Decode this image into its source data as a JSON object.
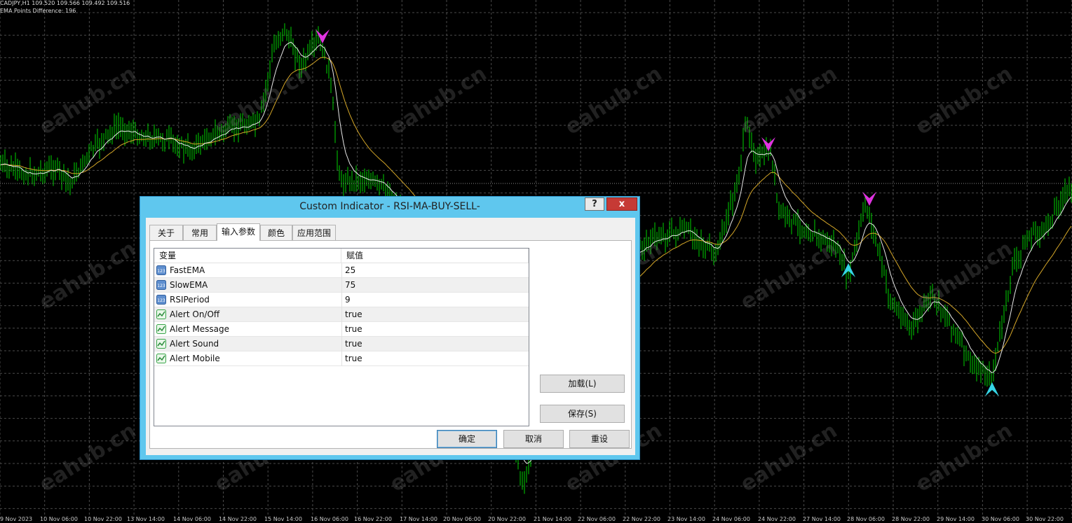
{
  "chart": {
    "header_line1": "CADJPY,H1  109.520 109.566 109.492 109.516",
    "header_line2": "EMA Points Difference: 196",
    "watermark": "eahub.cn",
    "x_ticks": [
      "9 Nov 2023",
      "10 Nov 06:00",
      "10 Nov 22:00",
      "13 Nov 14:00",
      "14 Nov 06:00",
      "14 Nov 22:00",
      "15 Nov 14:00",
      "16 Nov 06:00",
      "16 Nov 22:00",
      "17 Nov 14:00",
      "20 Nov 06:00",
      "20 Nov 22:00",
      "21 Nov 14:00",
      "22 Nov 06:00",
      "22 Nov 22:00",
      "23 Nov 14:00",
      "24 Nov 06:00",
      "24 Nov 22:00",
      "27 Nov 14:00",
      "28 Nov 06:00",
      "28 Nov 22:00",
      "29 Nov 14:00",
      "30 Nov 06:00",
      "30 Nov 22:00"
    ],
    "colors": {
      "background": "#000000",
      "grid": "#4a4a4a",
      "candles": "#00d200",
      "fast_ema": "#e8e8e8",
      "slow_ema": "#d4a628",
      "sell_arrow": "#e033e0",
      "buy_arrow": "#35d6e6"
    }
  },
  "dialog": {
    "title": "Custom Indicator - RSI-MA-BUY-SELL-",
    "help_label": "?",
    "close_label": "x",
    "tabs": [
      {
        "label": "关于"
      },
      {
        "label": "常用"
      },
      {
        "label": "输入参数"
      },
      {
        "label": "颜色"
      },
      {
        "label": "应用范围"
      }
    ],
    "table": {
      "col_variable": "变量",
      "col_value": "赋值",
      "rows": [
        {
          "name": "FastEMA",
          "value": "25",
          "icon": "integer-icon"
        },
        {
          "name": "SlowEMA",
          "value": "75",
          "icon": "integer-icon"
        },
        {
          "name": "RSIPeriod",
          "value": "9",
          "icon": "integer-icon"
        },
        {
          "name": "Alert On/Off",
          "value": "true",
          "icon": "boolean-icon"
        },
        {
          "name": "Alert Message",
          "value": "true",
          "icon": "boolean-icon"
        },
        {
          "name": "Alert Sound",
          "value": "true",
          "icon": "boolean-icon"
        },
        {
          "name": "Alert Mobile",
          "value": "true",
          "icon": "boolean-icon"
        }
      ]
    },
    "buttons": {
      "load": "加载(L)",
      "save": "保存(S)",
      "ok": "确定",
      "cancel": "取消",
      "reset": "重设"
    }
  }
}
